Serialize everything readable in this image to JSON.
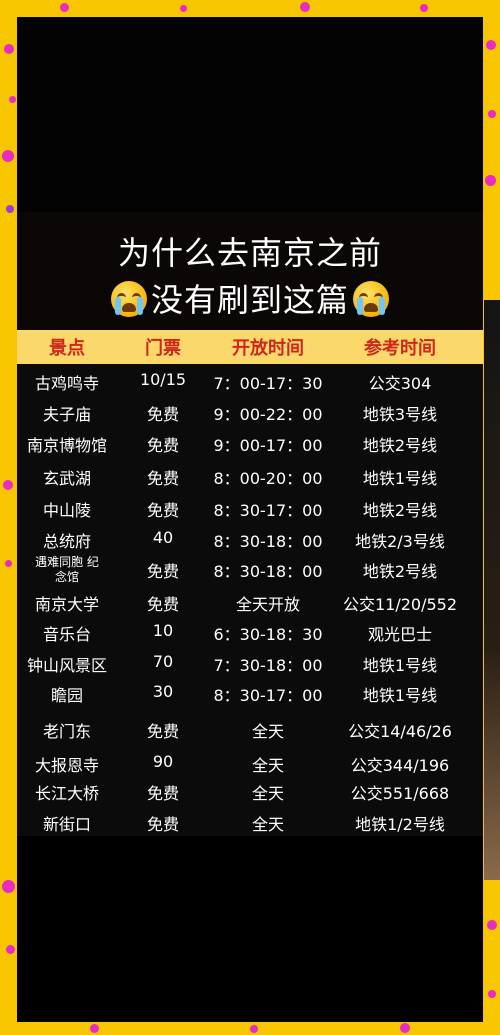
{
  "title": {
    "line1": "为什么去南京之前",
    "line2": "没有刷到这篇"
  },
  "icons": {
    "left_emoji": "loudly-crying-face-icon",
    "right_emoji": "loudly-crying-face-icon"
  },
  "colors": {
    "background": "#f7c600",
    "dots": "#e82bc4",
    "panel": "#000000",
    "header_bg": "#fbd86c",
    "header_text": "#d0261c",
    "body_text": "#ffffff"
  },
  "table": {
    "headers": [
      "景点",
      "门票",
      "开放时间",
      "参考时间"
    ],
    "rows": [
      [
        "古鸡鸣寺",
        "10/15",
        "7：00-17：30",
        "公交304"
      ],
      [
        "夫子庙",
        "免费",
        "9：00-22：00",
        "地铁3号线"
      ],
      [
        "南京博物馆",
        "免费",
        "9：00-17：00",
        "地铁2号线"
      ],
      [
        "玄武湖",
        "免费",
        "8：00-20：00",
        "地铁1号线"
      ],
      [
        "中山陵",
        "免费",
        "8：30-17：00",
        "地铁2号线"
      ],
      [
        "总统府",
        "40",
        "8：30-18：00",
        "地铁2/3号线"
      ],
      [
        "遇难同胞 纪念馆",
        "免费",
        "8：30-18：00",
        "地铁2号线"
      ],
      [
        "南京大学",
        "免费",
        "全天开放",
        "公交11/20/552"
      ],
      [
        "音乐台",
        "10",
        "6：30-18：30",
        "观光巴士"
      ],
      [
        "钟山风景区",
        "70",
        "7：30-18：00",
        "地铁1号线"
      ],
      [
        "瞻园",
        "30",
        "8：30-17：00",
        "地铁1号线"
      ],
      [
        "老门东",
        "免费",
        "全天",
        "公交14/46/26"
      ],
      [
        "大报恩寺",
        "90",
        "全天",
        "公交344/196"
      ],
      [
        "长江大桥",
        "免费",
        "全天",
        "公交551/668"
      ],
      [
        "新街口",
        "免费",
        "全天",
        "地铁1/2号线"
      ]
    ]
  }
}
